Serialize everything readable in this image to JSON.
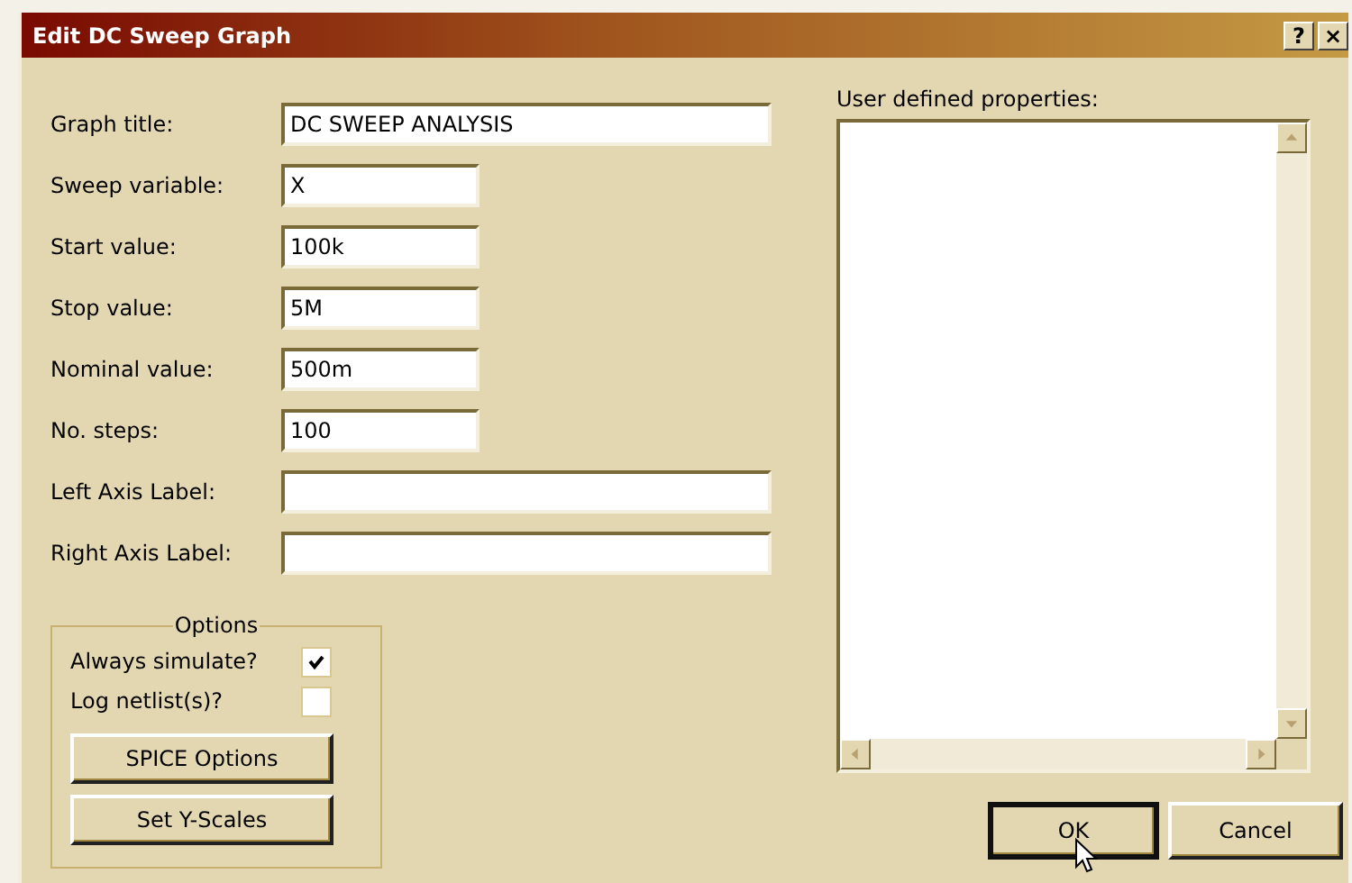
{
  "window": {
    "title": "Edit DC Sweep Graph",
    "title_buttons": [
      "?",
      "×"
    ]
  },
  "fields": [
    {
      "label": "Graph title:",
      "value": "DC SWEEP ANALYSIS",
      "kind": "wide"
    },
    {
      "label": "Sweep variable:",
      "value": "X",
      "kind": "short"
    },
    {
      "label": "Start value:",
      "value": "100k",
      "kind": "short"
    },
    {
      "label": "Stop value:",
      "value": "5M",
      "kind": "short"
    },
    {
      "label": "Nominal value:",
      "value": "500m",
      "kind": "short"
    },
    {
      "label": "No. steps:",
      "value": "100",
      "kind": "short"
    },
    {
      "label": "Left Axis Label:",
      "kind": "wide"
    },
    {
      "label": "Right Axis Label:",
      "kind": "wide"
    }
  ],
  "options": {
    "title": "Options",
    "checkboxes": [
      {
        "label": "Always simulate?",
        "checked": true
      },
      {
        "label": "Log netlist(s)?",
        "checked": false
      }
    ],
    "buttons": [
      "SPICE Options",
      "Set Y-Scales"
    ]
  },
  "user_properties": {
    "label": "User defined properties:"
  },
  "buttons": [
    {
      "label": "OK",
      "default": true
    },
    {
      "label": "Cancel",
      "default": false
    }
  ]
}
